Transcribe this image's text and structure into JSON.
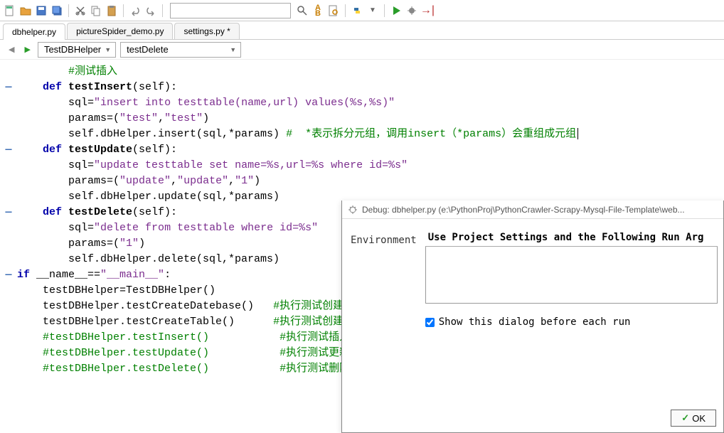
{
  "toolbar": {
    "search_placeholder": ""
  },
  "tabs": [
    {
      "label": "dbhelper.py",
      "active": true
    },
    {
      "label": "pictureSpider_demo.py",
      "active": false
    },
    {
      "label": "settings.py *",
      "active": false
    }
  ],
  "nav": {
    "class_select": "TestDBHelper",
    "method_select": "testDelete"
  },
  "code": {
    "l1": "        #测试插入",
    "l2a": "    def ",
    "l2b": "testInsert",
    "l2c": "(self):",
    "l3a": "        sql",
    "l3b": "=",
    "l3c": "\"insert into testtable(name,url) values(%s,%s)\"",
    "l4a": "        params",
    "l4b": "=(",
    "l4c": "\"test\"",
    "l4d": ",",
    "l4e": "\"test\"",
    "l4f": ")",
    "l5a": "        self.dbHelper.insert(sql,*params) ",
    "l5b": "#  *表示拆分元组，调用insert（*params）会重组成元组",
    "l6a": "    def ",
    "l6b": "testUpdate",
    "l6c": "(self):",
    "l7a": "        sql",
    "l7b": "=",
    "l7c": "\"update testtable set name=%s,url=%s where id=%s\"",
    "l8a": "        params",
    "l8b": "=(",
    "l8c": "\"update\"",
    "l8d": ",",
    "l8e": "\"update\"",
    "l8f": ",",
    "l8g": "\"1\"",
    "l8h": ")",
    "l9": "        self.dbHelper.update(sql,*params)",
    "l10a": "    def ",
    "l10b": "testDelete",
    "l10c": "(self):",
    "l11a": "        sql",
    "l11b": "=",
    "l11c": "\"delete from testtable where id=%s\"",
    "l12a": "        params",
    "l12b": "=(",
    "l12c": "\"1\"",
    "l12d": ")",
    "l13": "        self.dbHelper.delete(sql,*params)",
    "l14a": "if ",
    "l14b": "__name__",
    "l14c": "==",
    "l14d": "\"__main__\"",
    "l14e": ":",
    "l15": "    testDBHelper=TestDBHelper()",
    "l16a": "    testDBHelper.testCreateDatebase()   ",
    "l16b": "#执行测试创建数据库",
    "l17a": "    testDBHelper.testCreateTable()      ",
    "l17b": "#执行测试创建表",
    "l18a": "    #testDBHelper.testInsert()           ",
    "l18b": "#执行测试插入数据",
    "l19a": "    #testDBHelper.testUpdate()           ",
    "l19b": "#执行测试更新数据",
    "l20a": "    #testDBHelper.testDelete()           ",
    "l20b": "#执行测试删除数据"
  },
  "dialog": {
    "title": "Debug: dbhelper.py (e:\\PythonProj\\PythonCrawler-Scrapy-Mysql-File-Template\\web...",
    "env_label": "Environment",
    "heading": "Use Project Settings and the Following Run Arg",
    "checkbox_label": "Show this dialog before each run",
    "checkbox_checked": true,
    "ok_label": "OK"
  }
}
